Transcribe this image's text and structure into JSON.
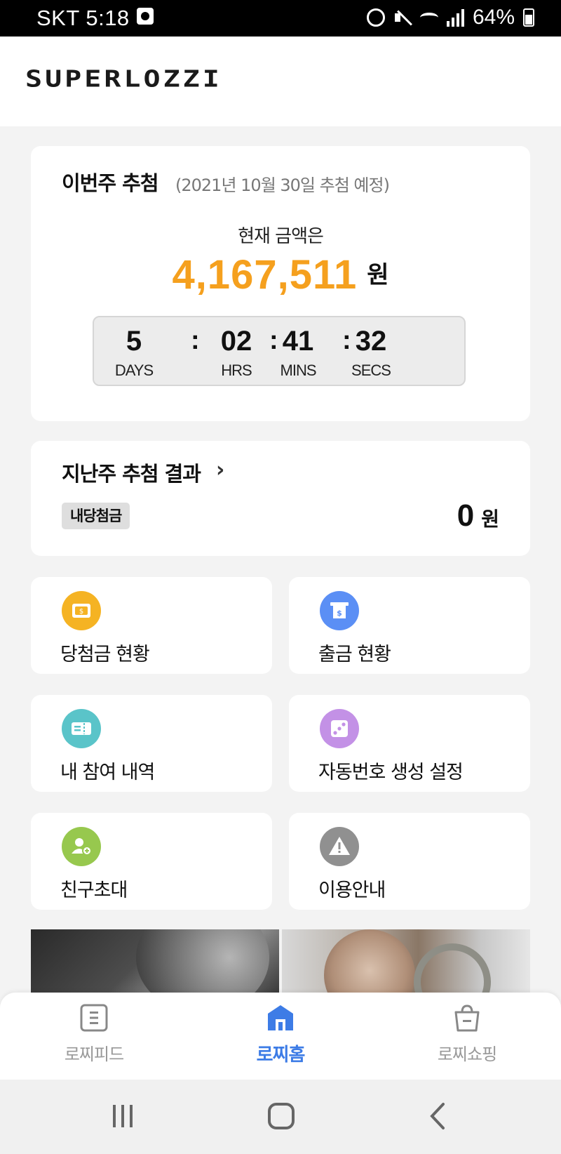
{
  "status_bar": {
    "carrier_time": "SKT 5:18",
    "battery": "64%"
  },
  "header": {
    "logo": "SUPERLOZZI"
  },
  "this_week": {
    "title": "이번주 추첨",
    "date": "(2021년 10월 30일 추첨 예정)",
    "amount_label": "현재 금액은",
    "amount": "4,167,511",
    "amount_unit": "원",
    "countdown": [
      {
        "value": "5",
        "label": "DAYS"
      },
      {
        "value": "02",
        "label": "HRS"
      },
      {
        "value": "41",
        "label": "MINS"
      },
      {
        "value": "32",
        "label": "SECS"
      }
    ],
    "separator": ":"
  },
  "last_week": {
    "title": "지난주 추첨 결과",
    "chevron": "›",
    "badge": "내당첨금",
    "prize": "0",
    "prize_unit": "원"
  },
  "menu": [
    {
      "label": "당첨금 현황",
      "icon": "wallet-icon",
      "color": "#f5b323"
    },
    {
      "label": "출금 현황",
      "icon": "atm-icon",
      "color": "#5b8ff5"
    },
    {
      "label": "내 참여 내역",
      "icon": "ticket-icon",
      "color": "#5ac4c9"
    },
    {
      "label": "자동번호 생성 설정",
      "icon": "dice-icon",
      "color": "#c391e6"
    },
    {
      "label": "친구초대",
      "icon": "add-friend-icon",
      "color": "#97c84e"
    },
    {
      "label": "이용안내",
      "icon": "warning-icon",
      "color": "#909090"
    }
  ],
  "bottom_nav": [
    {
      "label": "로찌피드",
      "icon": "feed-icon"
    },
    {
      "label": "로찌홈",
      "icon": "home-icon",
      "active": true
    },
    {
      "label": "로찌쇼핑",
      "icon": "shopping-bag-icon"
    }
  ],
  "colors": {
    "accent": "#3d7ce6",
    "amount": "#f5a01e"
  }
}
